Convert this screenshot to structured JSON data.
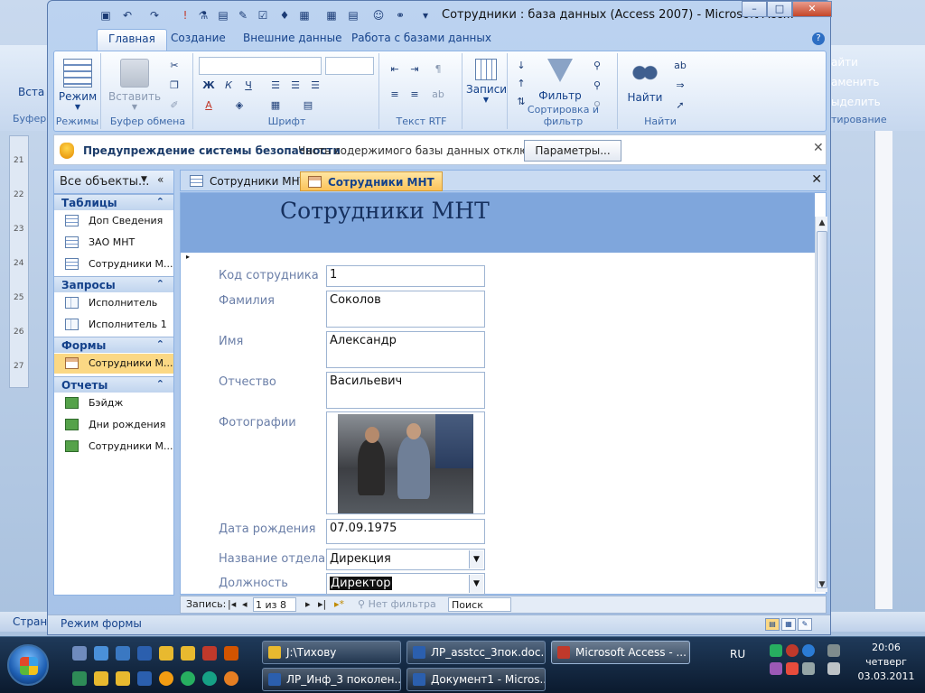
{
  "window": {
    "title": "Сотрудники : база данных (Access 2007) - Microsoft Acc...",
    "quick_access": [
      "save-icon",
      "undo-icon",
      "redo-icon",
      "filter-icon",
      "form-icon",
      "checkbox-icon",
      "customize-icon"
    ],
    "win_buttons": {
      "minimize": "–",
      "maximize": "□",
      "close": "✕"
    }
  },
  "ribbon": {
    "tabs": [
      "Главная",
      "Создание",
      "Внешние данные",
      "Работа с базами данных"
    ],
    "active_tab": "Главная",
    "help": "?",
    "groups": {
      "views": {
        "label": "Режимы",
        "button": "Режим"
      },
      "clipboard": {
        "label": "Буфер обмена",
        "button": "Вставить"
      },
      "font": {
        "label": "Шрифт",
        "bold": "Ж",
        "italic": "К",
        "underline": "Ч",
        "fontcolor": "A"
      },
      "rtf": {
        "label": "Текст RTF"
      },
      "records": {
        "label": "",
        "button": "Записи"
      },
      "sort": {
        "label": "Сортировка и фильтр",
        "button": "Фильтр"
      },
      "find": {
        "label": "Найти",
        "button": "Найти"
      }
    }
  },
  "security": {
    "title": "Предупреждение системы безопасности",
    "message": "Часть содержимого базы данных отключено",
    "button": "Параметры...",
    "close": "✕"
  },
  "nav": {
    "header": "Все объекты...",
    "sections": [
      {
        "label": "Таблицы",
        "items": [
          "Доп Сведения",
          "ЗАО МНТ",
          "Сотрудники М..."
        ]
      },
      {
        "label": "Запросы",
        "items": [
          "Исполнитель",
          "Исполнитель 1"
        ]
      },
      {
        "label": "Формы",
        "items": [
          "Сотрудники М..."
        ]
      },
      {
        "label": "Отчеты",
        "items": [
          "Бэйдж",
          "Дни рождения",
          "Сотрудники М..."
        ]
      }
    ]
  },
  "doc_tabs": [
    {
      "label": "Сотрудники МНТ",
      "active": false
    },
    {
      "label": "Сотрудники МНТ",
      "active": true
    }
  ],
  "form": {
    "title": "Сотрудники МНТ",
    "fields": {
      "code": {
        "label": "Код сотрудника",
        "value": "1"
      },
      "surname": {
        "label": "Фамилия",
        "value": "Соколов"
      },
      "name": {
        "label": "Имя",
        "value": "Александр"
      },
      "patronymic": {
        "label": "Отчество",
        "value": "Васильевич"
      },
      "photo": {
        "label": "Фотографии"
      },
      "birthdate": {
        "label": "Дата рождения",
        "value": "07.09.1975"
      },
      "department": {
        "label": "Название отдела",
        "value": "Дирекция"
      },
      "position": {
        "label": "Должность",
        "value": "Директор"
      }
    }
  },
  "record_bar": {
    "label": "Запись:",
    "current": "1 из 8",
    "filter": "Нет фильтра",
    "search": "Поиск"
  },
  "status": {
    "text": "Режим формы"
  },
  "background_app": {
    "ribbon_right": [
      "айти",
      "аменить",
      "ыделить",
      "тирование"
    ],
    "paste_label": "Вста",
    "buffer_label": "Буфер",
    "status": "Стран",
    "ruler_numbers": [
      "21",
      "22",
      "23",
      "24",
      "25",
      "26",
      "27"
    ]
  },
  "taskbar": {
    "row1": [
      {
        "label": "J:\\Тихову",
        "active": false
      },
      {
        "label": "ЛР_asstcc_3пок.doc...",
        "active": false
      },
      {
        "label": "Microsoft Access - ...",
        "active": true
      }
    ],
    "row2": [
      {
        "label": "ЛР_Инф_3 поколен...",
        "active": false
      },
      {
        "label": "Документ1 - Micros...",
        "active": false
      }
    ],
    "lang": "RU",
    "clock": {
      "time": "20:06",
      "day": "четверг",
      "date": "03.03.2011"
    }
  }
}
